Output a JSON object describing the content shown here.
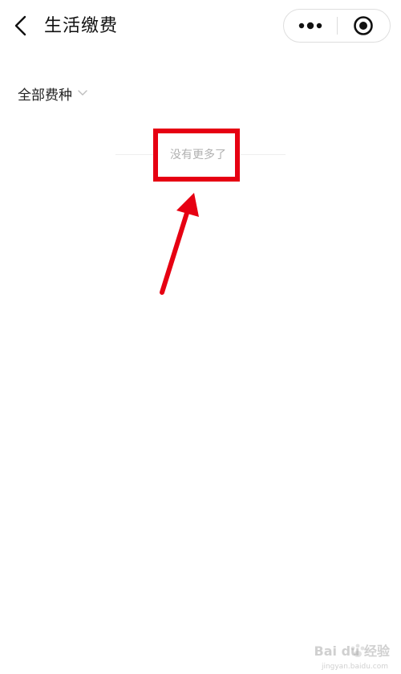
{
  "header": {
    "title": "生活缴费",
    "back_icon": "chevron-left-icon",
    "more_icon": "more-dots-icon",
    "close_icon": "target-circle-icon"
  },
  "filter": {
    "label": "全部费种",
    "chevron_icon": "chevron-down-icon"
  },
  "list": {
    "end_text": "没有更多了"
  },
  "annotation": {
    "color": "#e60012"
  },
  "watermark": {
    "brand": "Bai du 经验",
    "url": "jingyan.baidu.com"
  },
  "colors": {
    "text_primary": "#111111",
    "text_muted": "#b0b0b0",
    "annotation_red": "#e60012"
  }
}
